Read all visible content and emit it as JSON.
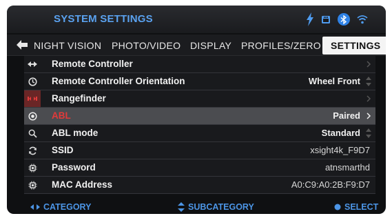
{
  "header": {
    "title": "SYSTEM SETTINGS",
    "status_icons": [
      "lightning-bolt-icon",
      "sd-card-icon",
      "bluetooth-icon",
      "wifi-icon"
    ],
    "title_color": "#5aa2f0"
  },
  "tabs": [
    {
      "label": "NIGHT VISION",
      "active": false
    },
    {
      "label": "PHOTO/VIDEO",
      "active": false
    },
    {
      "label": "DISPLAY",
      "active": false
    },
    {
      "label": "PROFILES/ZERO",
      "active": false
    },
    {
      "label": "SETTINGS",
      "active": true
    }
  ],
  "rows": [
    {
      "icon": "remote-arrows-icon",
      "label": "Remote Controller",
      "value": "",
      "control": "chevron"
    },
    {
      "icon": "clock-icon",
      "label": "Remote Controller Orientation",
      "value": "Wheel Front",
      "control": "updown"
    },
    {
      "icon": "rangefinder-icon",
      "label": "Rangefinder",
      "value": "",
      "control": "chevron"
    },
    {
      "icon": "target-icon",
      "label": "ABL",
      "value": "Paired",
      "control": "chevron"
    },
    {
      "icon": "search-icon",
      "label": "ABL mode",
      "value": "Standard",
      "control": "updown"
    },
    {
      "icon": "refresh-icon",
      "label": "SSID",
      "value": "xsight4k_F9D7",
      "control": "none"
    },
    {
      "icon": "chip-icon",
      "label": "Password",
      "value": "atnsmarthd",
      "control": "none"
    },
    {
      "icon": "chip-icon",
      "label": "MAC Address",
      "value": "A0:C9:A0:2B:F9:D7",
      "control": "none"
    }
  ],
  "footer": {
    "category": "CATEGORY",
    "subcategory": "SUBCATEGORY",
    "select": "SELECT"
  },
  "colors": {
    "accent_blue": "#4c95e6",
    "abl_red": "#e23a3a",
    "selected_row": "#4b4c50"
  }
}
